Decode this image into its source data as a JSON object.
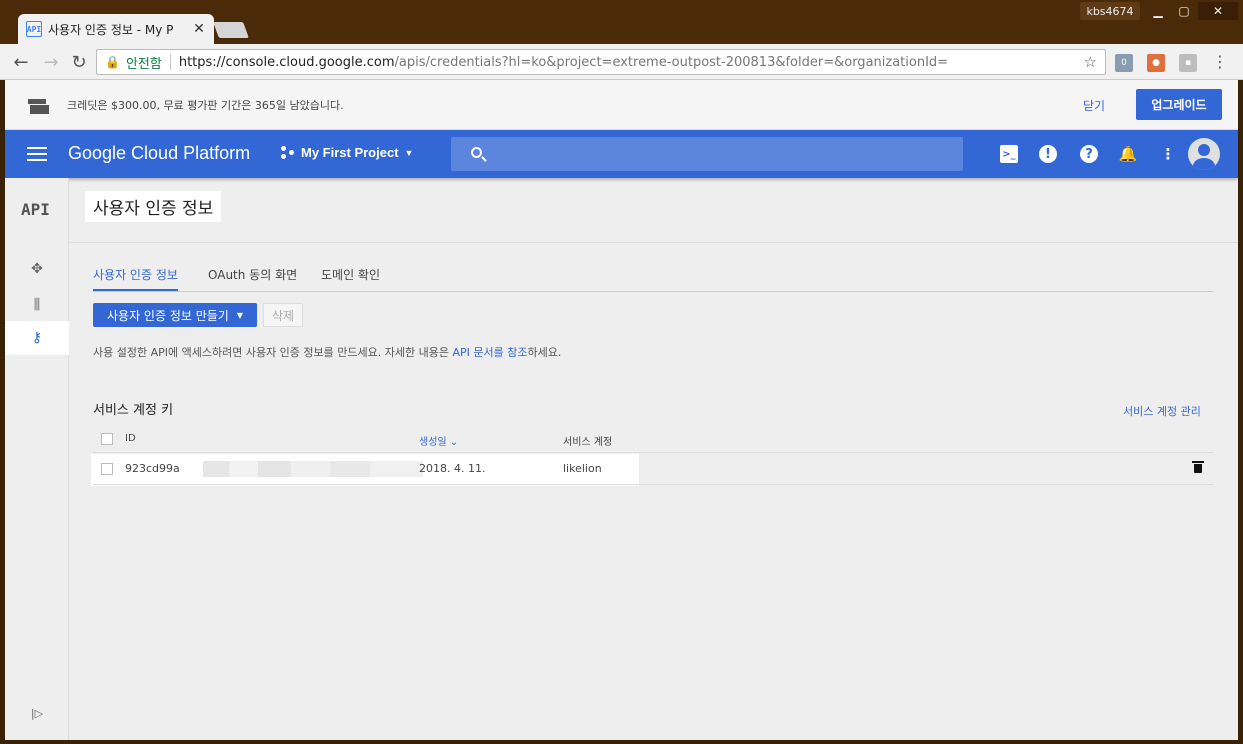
{
  "browser": {
    "tab_title": "사용자 인증 정보 - My P",
    "tab_favicon": "API",
    "user": "kbs4674",
    "secure_label": "안전함",
    "url_host": "https://console.cloud.google.com",
    "url_rest": "/apis/credentials?hl=ko&project=extreme-outpost-200813&folder=&organizationId="
  },
  "banner": {
    "text": "크레딧은 $300.00, 무료 평가판 기간은 365일 남았습니다.",
    "close_label": "닫기",
    "upgrade_label": "업그레이드"
  },
  "appbar": {
    "title": "Google Cloud Platform",
    "project": "My First Project"
  },
  "sidenav": {
    "api_label": "API"
  },
  "page": {
    "title": "사용자 인증 정보",
    "tabs": [
      {
        "label": "사용자 인증 정보"
      },
      {
        "label": "OAuth 동의 화면"
      },
      {
        "label": "도메인 확인"
      }
    ],
    "create_button": "사용자 인증 정보 만들기",
    "delete_button": "삭제",
    "hint_before": "사용 설정한 API에 액세스하려면 사용자 인증 정보를 만드세요. 자세한 내용은 ",
    "hint_link": "API 문서를 참조",
    "hint_after": "하세요.",
    "section_title": "서비스 계정 키",
    "manage_link": "서비스 계정 관리",
    "columns": {
      "id": "ID",
      "created": "생성일",
      "account": "서비스 계정"
    },
    "rows": [
      {
        "id": "923cd99a",
        "created": "2018. 4. 11.",
        "account": "likelion"
      }
    ]
  },
  "colors": {
    "accent": "#3367d6",
    "frame": "#4b2a0a"
  }
}
